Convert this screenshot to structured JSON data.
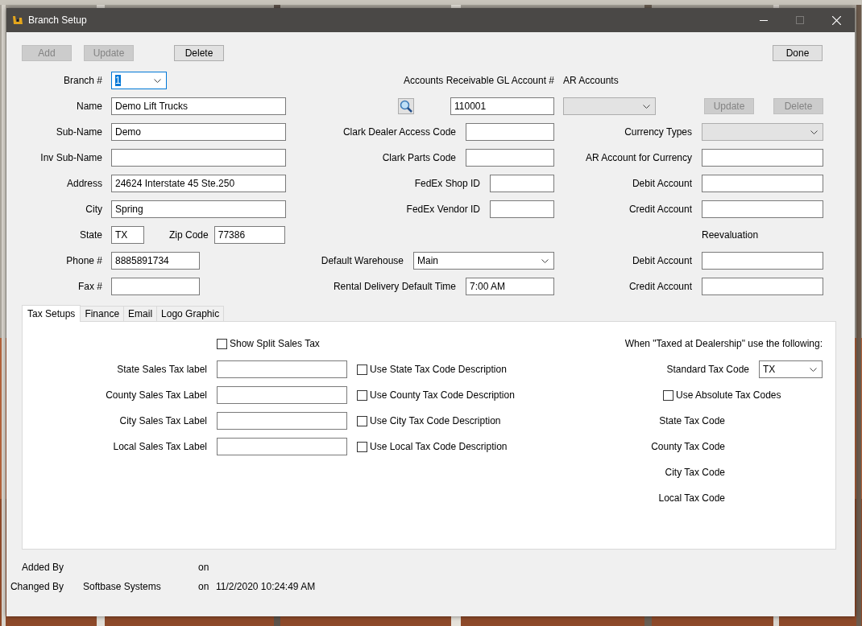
{
  "window": {
    "title": "Branch Setup"
  },
  "toolbar": [
    {
      "label": "Add",
      "disabled": true
    },
    {
      "label": "Update",
      "disabled": true
    },
    {
      "label": "Delete",
      "disabled": false
    }
  ],
  "done_button": {
    "label": "Done",
    "disabled": false
  },
  "branch_fields": [
    {
      "label": "Branch #",
      "kind": "combo",
      "value": "1",
      "focused": true
    },
    {
      "label": "Name",
      "kind": "text",
      "value": "Demo Lift Trucks",
      "focused": false
    },
    {
      "label": "Sub-Name",
      "kind": "text",
      "value": "Demo",
      "focused": false
    },
    {
      "label": "Inv Sub-Name",
      "kind": "text",
      "focused": false
    },
    {
      "label": "Address",
      "kind": "text",
      "value": "24624 Interstate 45 Ste.250",
      "focused": false
    },
    {
      "label": "City",
      "kind": "text",
      "value": "Spring",
      "focused": false
    },
    {
      "label": "State",
      "kind": "text",
      "value": "TX",
      "focused": false,
      "extra": {
        "label": "Zip Code",
        "value": "77386"
      }
    },
    {
      "label": "Phone #",
      "kind": "text",
      "value": "8885891734",
      "focused": false
    },
    {
      "label": "Fax #",
      "kind": "text",
      "focused": false
    }
  ],
  "ar_gl_account": {
    "label": "Accounts Receivable GL Account #",
    "value": "110001"
  },
  "middle_fields": [
    {
      "label": "Clark Dealer Access Code",
      "kind": "text"
    },
    {
      "label": "Clark Parts Code",
      "kind": "text"
    },
    {
      "label": "FedEx Shop ID",
      "kind": "text"
    },
    {
      "label": "FedEx Vendor ID",
      "kind": "text"
    },
    {
      "label": "Default Warehouse",
      "kind": "combo",
      "value": "Main"
    },
    {
      "label": "Rental Delivery Default Time",
      "kind": "text",
      "value": "7:00 AM"
    }
  ],
  "ar_accounts": {
    "label": "AR Accounts",
    "combo_disabled": true,
    "buttons": [
      {
        "label": "Update",
        "disabled": true
      },
      {
        "label": "Delete",
        "disabled": true
      }
    ]
  },
  "currency_fields": [
    {
      "label": "Currency Types",
      "kind": "combo",
      "disabled": true
    },
    {
      "label": "AR Account for Currency",
      "kind": "text",
      "disabled": false
    },
    {
      "label": "Debit Account",
      "kind": "text",
      "disabled": false
    },
    {
      "label": "Credit Account",
      "kind": "text",
      "disabled": false
    },
    {
      "label": "Reevaluation",
      "kind": "heading"
    },
    {
      "label": "Debit Account",
      "kind": "text",
      "disabled": false
    },
    {
      "label": "Credit Account",
      "kind": "text",
      "disabled": false
    }
  ],
  "tabs": [
    {
      "label": "Tax Setups",
      "selected": true
    },
    {
      "label": "Finance",
      "selected": false
    },
    {
      "label": "Email",
      "selected": false
    },
    {
      "label": "Logo Graphic",
      "selected": false
    }
  ],
  "tax_setups": {
    "show_split": {
      "label": "Show Split Sales Tax",
      "checked": false
    },
    "rows": [
      {
        "label": "State Sales Tax label",
        "option": {
          "label": "Use State Tax Code Description",
          "checked": false
        }
      },
      {
        "label": "County Sales Tax Label",
        "option": {
          "label": "Use County Tax Code Description",
          "checked": false
        }
      },
      {
        "label": "City Sales Tax Label",
        "option": {
          "label": "Use City Tax Code Description",
          "checked": false
        }
      },
      {
        "label": "Local Sales Tax Label",
        "option": {
          "label": "Use Local Tax Code Description",
          "checked": false
        }
      }
    ],
    "dealership": {
      "heading": "When \"Taxed at Dealership\" use the following:",
      "standard": {
        "label": "Standard Tax Code",
        "value": "TX"
      },
      "absolute": {
        "label": "Use Absolute Tax Codes",
        "checked": false
      },
      "codes": [
        "State Tax Code",
        "County Tax Code",
        "City Tax Code",
        "Local Tax Code"
      ]
    }
  },
  "footer": [
    {
      "label": "Added By",
      "on": "on"
    },
    {
      "label": "Changed By",
      "user": "Softbase Systems",
      "on": "on",
      "date": "11/2/2020 10:24:49 AM"
    }
  ]
}
